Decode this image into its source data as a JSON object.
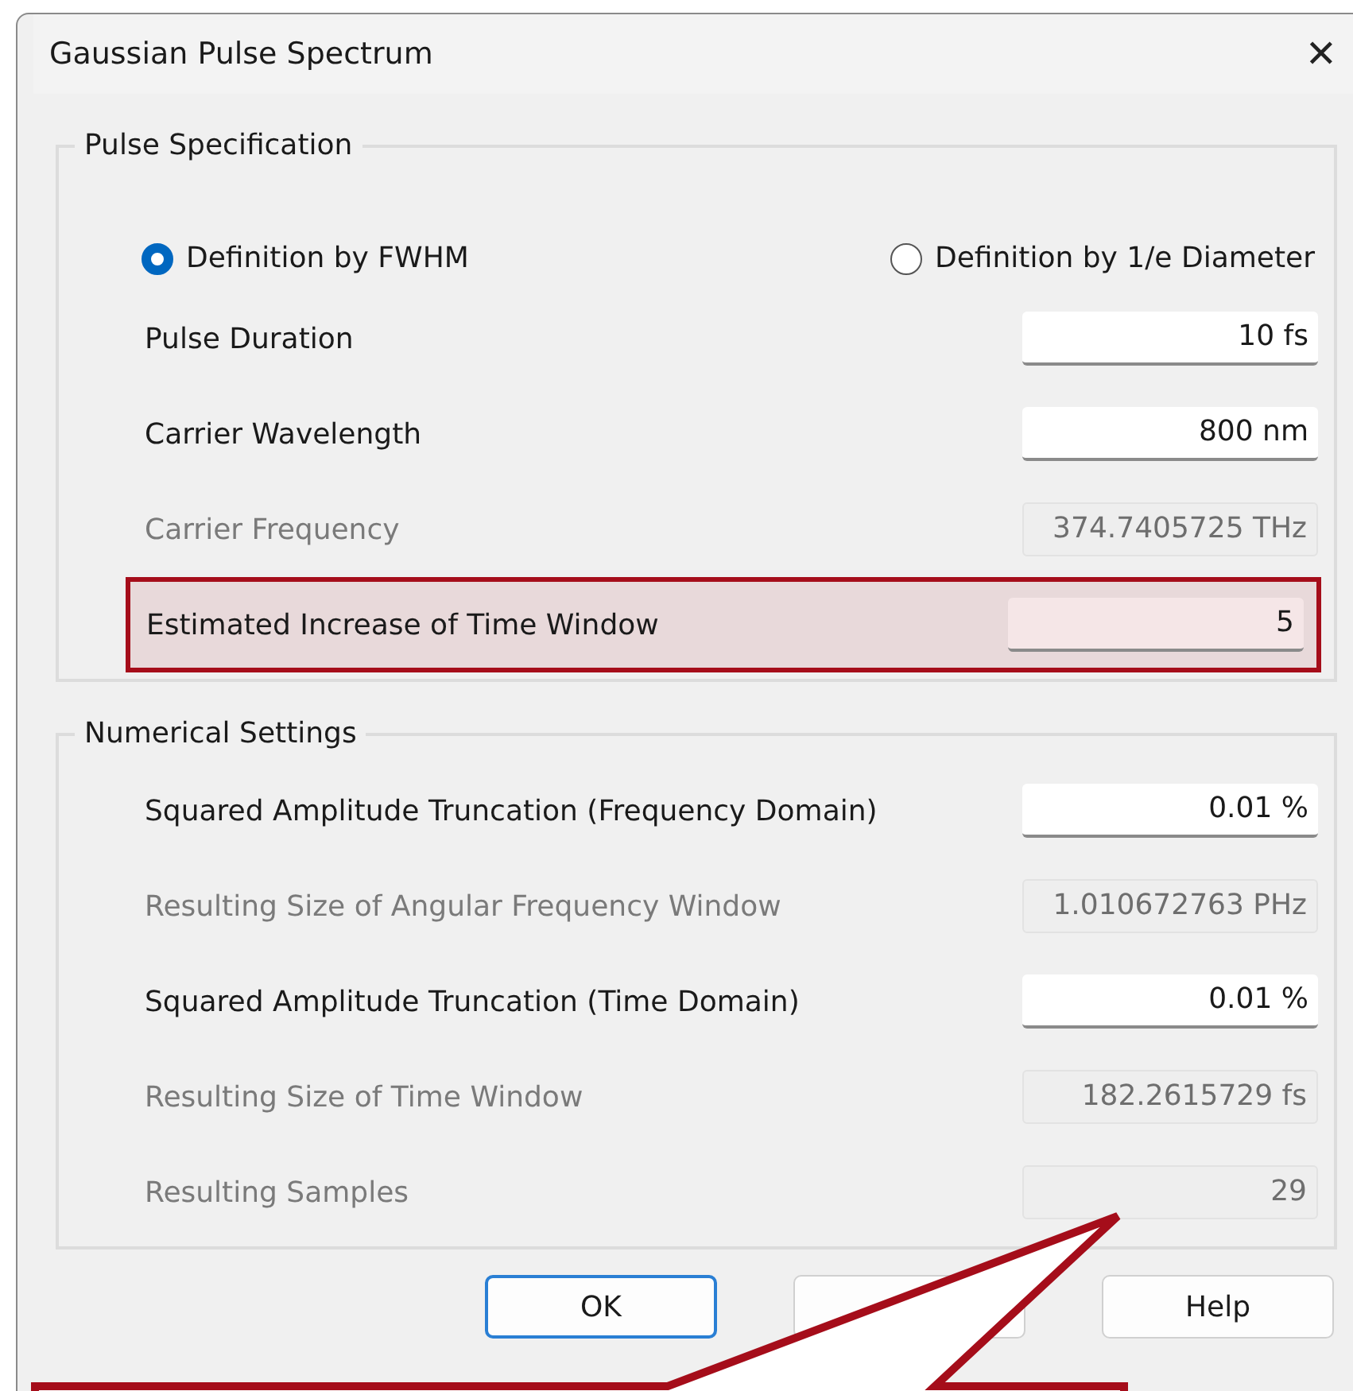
{
  "window": {
    "title": "Gaussian Pulse Spectrum",
    "close": "✕"
  },
  "groups": [
    {
      "title": "Pulse Specification",
      "radios": [
        {
          "label": "Definition by FWHM",
          "selected": true
        },
        {
          "label": "Definition by 1/e Diameter",
          "selected": false
        }
      ],
      "rows": [
        {
          "label": "Pulse Duration",
          "value": "10 fs",
          "disabled": false,
          "highlighted": false
        },
        {
          "label": "Carrier Wavelength",
          "value": "800 nm",
          "disabled": false,
          "highlighted": false
        },
        {
          "label": "Carrier Frequency",
          "value": "374.7405725 THz",
          "disabled": true,
          "highlighted": false
        },
        {
          "label": "Estimated Increase of Time Window",
          "value": "5",
          "disabled": false,
          "highlighted": true
        }
      ]
    },
    {
      "title": "Numerical Settings",
      "rows": [
        {
          "label": "Squared Amplitude Truncation (Frequency Domain)",
          "value": "0.01 %",
          "disabled": false,
          "highlighted": false
        },
        {
          "label": "Resulting Size of Angular Frequency Window",
          "value": "1.010672763 PHz",
          "disabled": true,
          "highlighted": false
        },
        {
          "label": "Squared Amplitude Truncation (Time Domain)",
          "value": "0.01 %",
          "disabled": false,
          "highlighted": false
        },
        {
          "label": "Resulting Size of Time Window",
          "value": "182.2615729 fs",
          "disabled": true,
          "highlighted": false
        },
        {
          "label": "Resulting Samples",
          "value": "29",
          "disabled": true,
          "highlighted": false
        }
      ]
    }
  ],
  "buttons": [
    {
      "label": "OK",
      "default": true
    },
    {
      "default": false
    },
    {
      "label": "Help",
      "default": false
    }
  ]
}
